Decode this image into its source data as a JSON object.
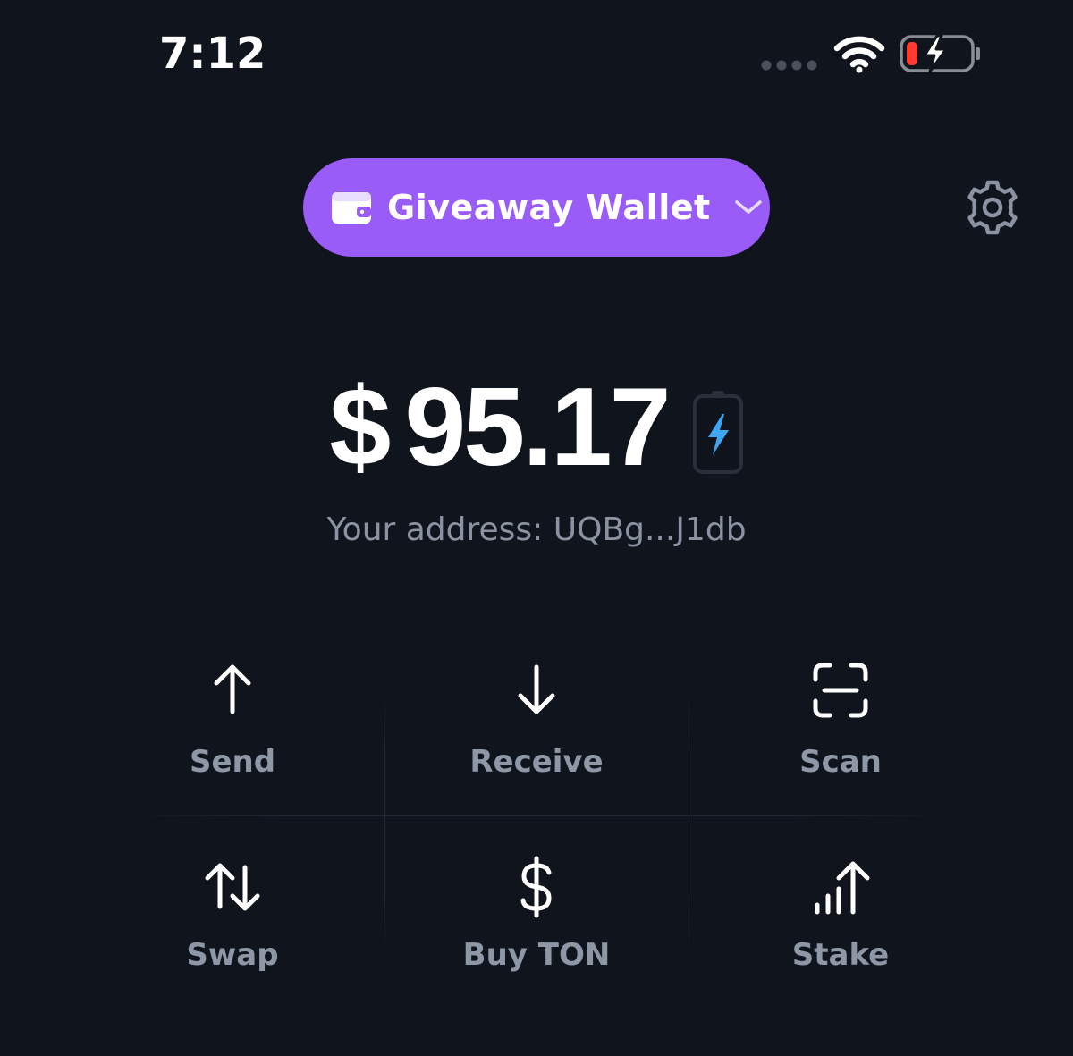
{
  "status_bar": {
    "time": "7:12"
  },
  "header": {
    "wallet_name": "Giveaway Wallet"
  },
  "balance": {
    "currency_symbol": "$",
    "amount": "95.17"
  },
  "address_line": "Your address: UQBg...J1db",
  "actions": [
    {
      "label": "Send",
      "icon": "arrow-up-icon"
    },
    {
      "label": "Receive",
      "icon": "arrow-down-icon"
    },
    {
      "label": "Scan",
      "icon": "scan-icon"
    },
    {
      "label": "Swap",
      "icon": "swap-icon"
    },
    {
      "label": "Buy TON",
      "icon": "dollar-icon"
    },
    {
      "label": "Stake",
      "icon": "stake-icon"
    }
  ],
  "colors": {
    "background": "#10141d",
    "accent": "#9a5cf6",
    "label": "#8e97a6",
    "muted_text": "#8b93a2",
    "lightning": "#3ea7f4",
    "battery_low": "#ff3b30"
  }
}
